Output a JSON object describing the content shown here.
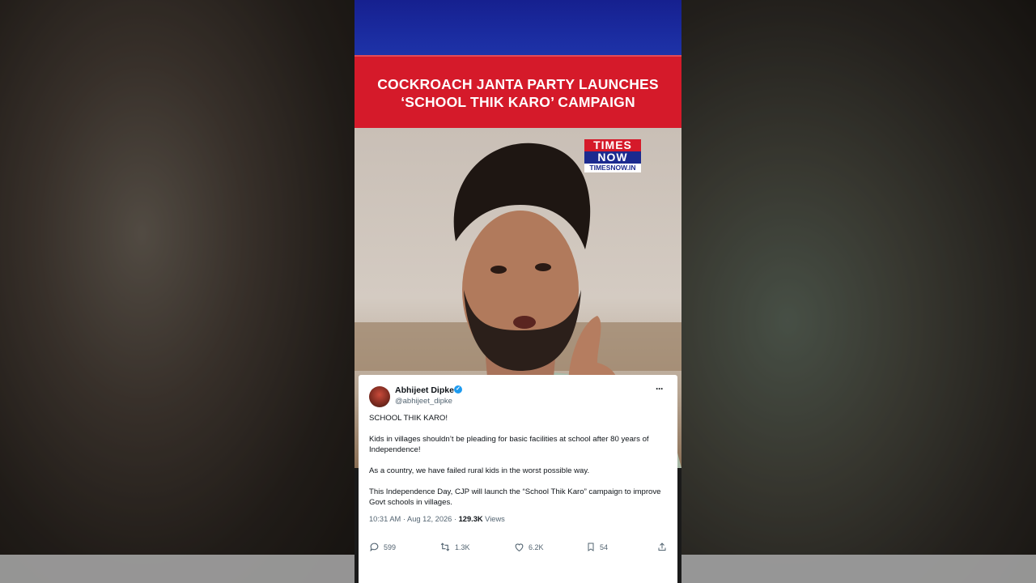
{
  "headline": {
    "line1": "COCKROACH JANTA PARTY LAUNCHES",
    "line2": "‘SCHOOL THIK KARO’ CAMPAIGN"
  },
  "logo": {
    "top": "TIMES",
    "bottom": "NOW",
    "url": "TIMESNOW.IN"
  },
  "tweet": {
    "author_name": "Abhijeet Dipke",
    "handle": "@abhijeet_dipke",
    "more_icon": "···",
    "paragraphs": [
      "SCHOOL THIK KARO!",
      "Kids in villages shouldn’t be pleading for basic facilities at school after 80 years of Independence!",
      "As a country, we have failed rural kids in the worst possible way.",
      "This Independence Day, CJP will launch the “School Thik Karo” campaign to improve Govt schools in villages."
    ],
    "timestamp": "10:31 AM · Aug 12, 2026 · ",
    "views_count": "129.3K",
    "views_label": " Views",
    "actions": {
      "replies": "599",
      "retweets": "1.3K",
      "likes": "6.2K",
      "bookmarks": "54"
    }
  },
  "colors": {
    "headline_bg": "#d51a2a",
    "top_band": "#1a2a9e",
    "verified": "#1d9bf0"
  }
}
